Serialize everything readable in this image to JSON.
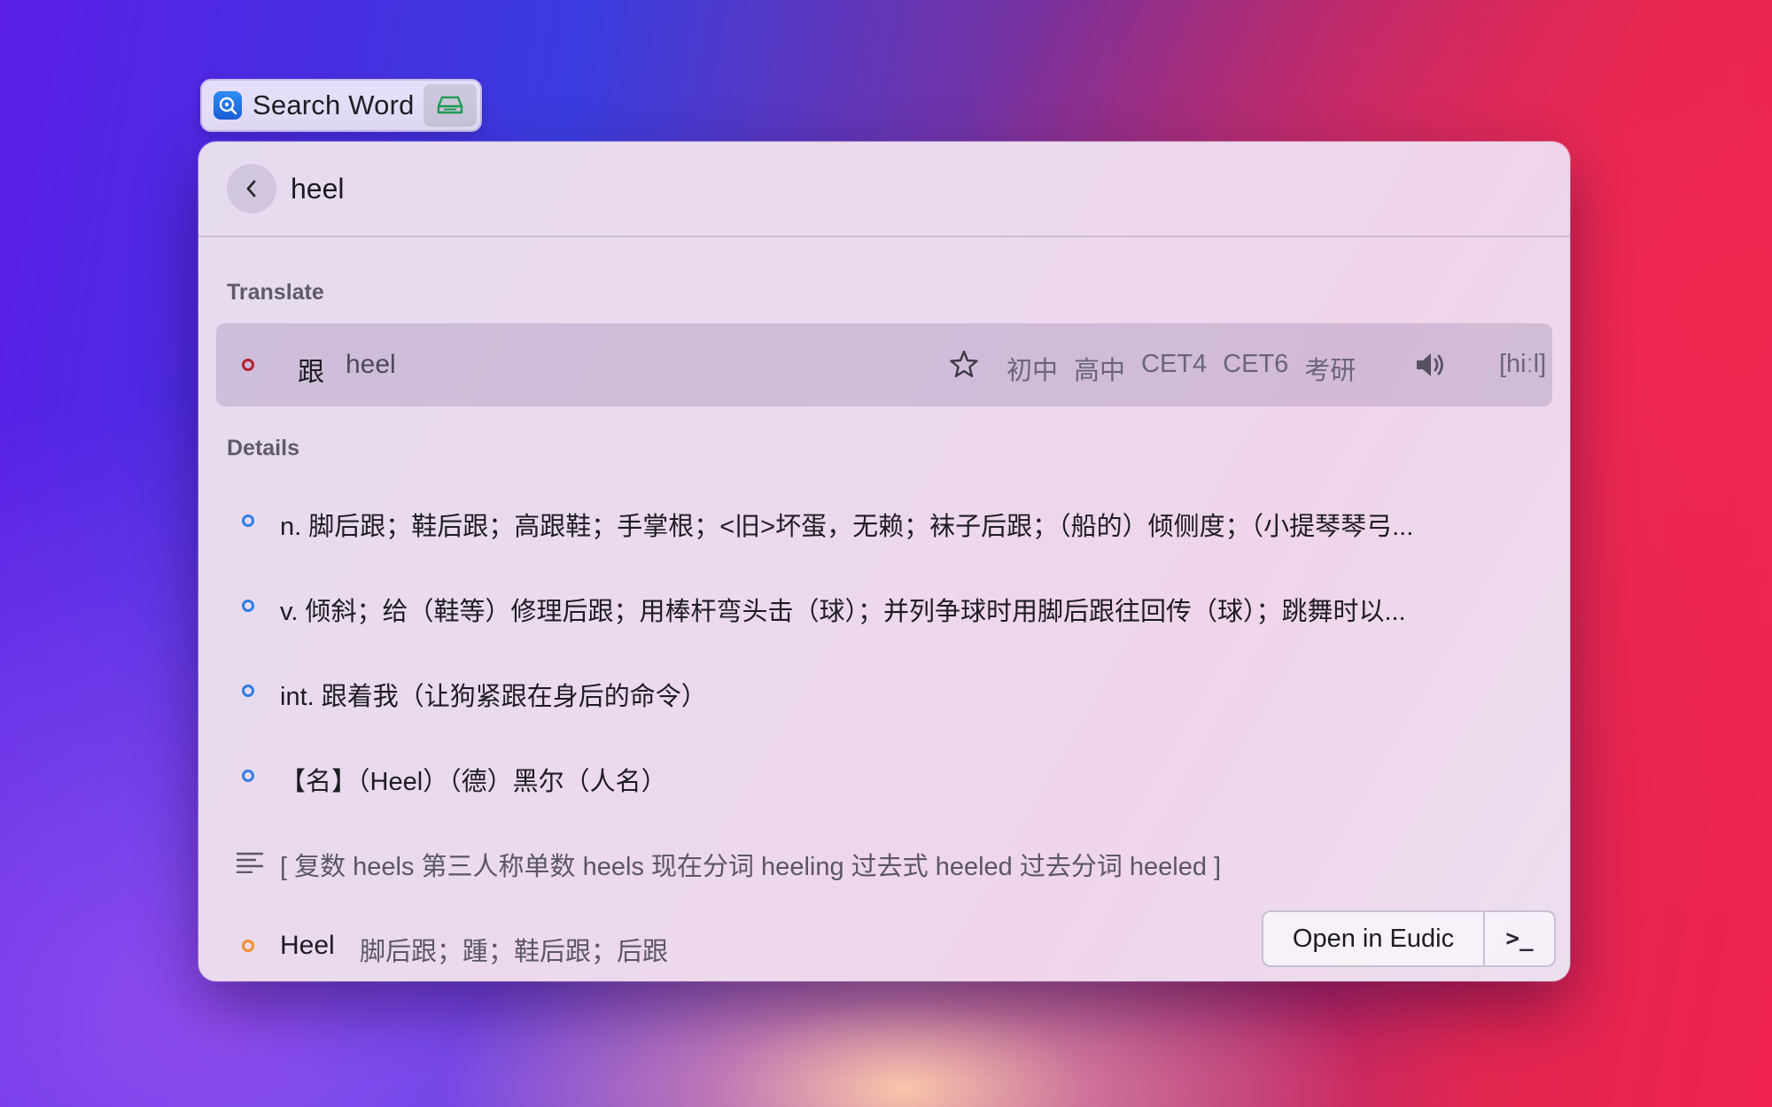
{
  "window": {
    "title": "Search Word"
  },
  "search": {
    "query": "heel"
  },
  "sections": {
    "translate_label": "Translate",
    "details_label": "Details"
  },
  "translate": {
    "word": "跟",
    "source": "heel",
    "tags": [
      "初中",
      "高中",
      "CET4",
      "CET6",
      "考研"
    ],
    "phonetic": "[hiːl]"
  },
  "details": [
    {
      "text": "n. 脚后跟；鞋后跟；高跟鞋；手掌根；<旧>坏蛋，无赖；袜子后跟；（船的）倾侧度；（小提琴琴弓..."
    },
    {
      "text": "v. 倾斜；给（鞋等）修理后跟；用棒杆弯头击（球）；并列争球时用脚后跟往回传（球）；跳舞时以..."
    },
    {
      "text": "int. 跟着我（让狗紧跟在身后的命令）"
    },
    {
      "text": "【名】（Heel）（德）黑尔（人名）"
    }
  ],
  "forms": {
    "text": "[ 复数 heels   第三人称单数 heels   现在分词 heeling   过去式 heeled   过去分词 heeled ]"
  },
  "last_item": {
    "word": "Heel",
    "definition": "脚后跟；踵；鞋后跟；后跟"
  },
  "actions": {
    "open_label": "Open in Eudic",
    "terminal_label": ">_"
  },
  "colors": {
    "translate_ring": "#b4232f",
    "detail_ring": "#2f7de6",
    "last_ring": "#f0902a",
    "drive_icon": "#1f9d55"
  },
  "icons": {
    "app": "eudic-app-icon",
    "drive": "drive-icon",
    "back": "chevron-left-icon",
    "star": "star-icon",
    "speaker": "speaker-icon",
    "forms": "text-lines-icon"
  }
}
